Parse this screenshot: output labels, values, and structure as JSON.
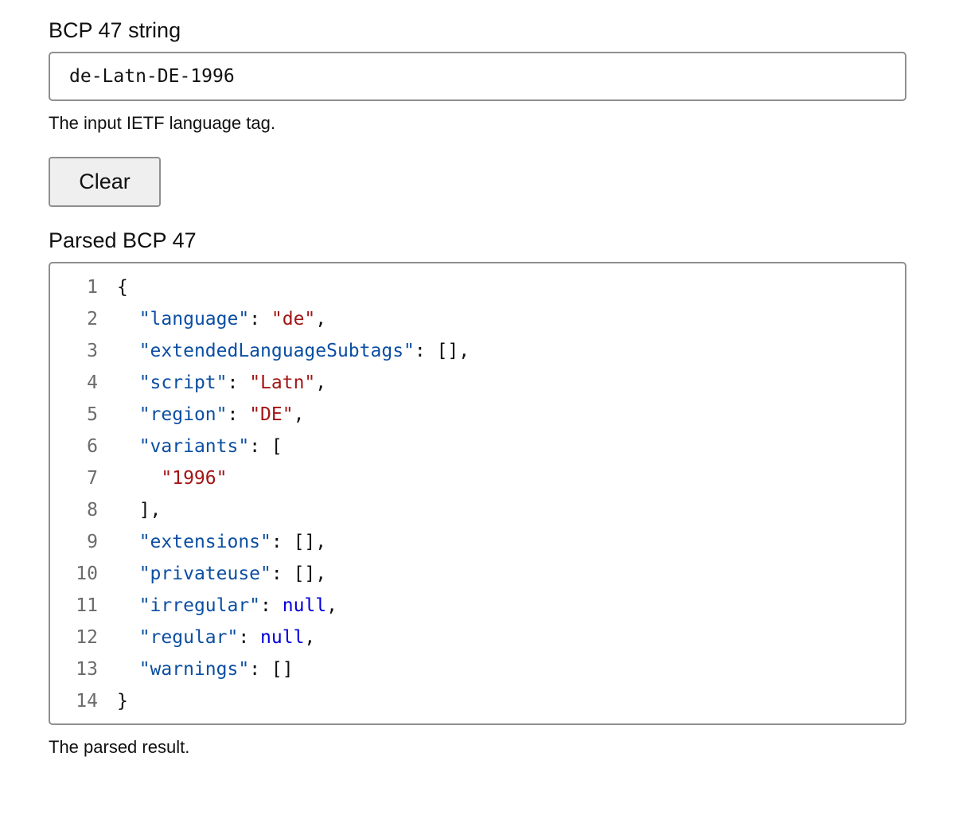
{
  "input_section": {
    "label": "BCP 47 string",
    "value": "de-Latn-DE-1996",
    "help": "The input IETF language tag."
  },
  "clear_button": {
    "label": "Clear"
  },
  "output_section": {
    "label": "Parsed BCP 47",
    "help": "The parsed result.",
    "lines": [
      [
        {
          "t": "punc",
          "v": "{"
        }
      ],
      [
        {
          "t": "punc",
          "v": "  "
        },
        {
          "t": "key",
          "v": "\"language\""
        },
        {
          "t": "punc",
          "v": ": "
        },
        {
          "t": "str",
          "v": "\"de\""
        },
        {
          "t": "punc",
          "v": ","
        }
      ],
      [
        {
          "t": "punc",
          "v": "  "
        },
        {
          "t": "key",
          "v": "\"extendedLanguageSubtags\""
        },
        {
          "t": "punc",
          "v": ": [],"
        }
      ],
      [
        {
          "t": "punc",
          "v": "  "
        },
        {
          "t": "key",
          "v": "\"script\""
        },
        {
          "t": "punc",
          "v": ": "
        },
        {
          "t": "str",
          "v": "\"Latn\""
        },
        {
          "t": "punc",
          "v": ","
        }
      ],
      [
        {
          "t": "punc",
          "v": "  "
        },
        {
          "t": "key",
          "v": "\"region\""
        },
        {
          "t": "punc",
          "v": ": "
        },
        {
          "t": "str",
          "v": "\"DE\""
        },
        {
          "t": "punc",
          "v": ","
        }
      ],
      [
        {
          "t": "punc",
          "v": "  "
        },
        {
          "t": "key",
          "v": "\"variants\""
        },
        {
          "t": "punc",
          "v": ": ["
        }
      ],
      [
        {
          "t": "punc",
          "v": "    "
        },
        {
          "t": "str",
          "v": "\"1996\""
        }
      ],
      [
        {
          "t": "punc",
          "v": "  ],"
        }
      ],
      [
        {
          "t": "punc",
          "v": "  "
        },
        {
          "t": "key",
          "v": "\"extensions\""
        },
        {
          "t": "punc",
          "v": ": [],"
        }
      ],
      [
        {
          "t": "punc",
          "v": "  "
        },
        {
          "t": "key",
          "v": "\"privateuse\""
        },
        {
          "t": "punc",
          "v": ": [],"
        }
      ],
      [
        {
          "t": "punc",
          "v": "  "
        },
        {
          "t": "key",
          "v": "\"irregular\""
        },
        {
          "t": "punc",
          "v": ": "
        },
        {
          "t": "lit",
          "v": "null"
        },
        {
          "t": "punc",
          "v": ","
        }
      ],
      [
        {
          "t": "punc",
          "v": "  "
        },
        {
          "t": "key",
          "v": "\"regular\""
        },
        {
          "t": "punc",
          "v": ": "
        },
        {
          "t": "lit",
          "v": "null"
        },
        {
          "t": "punc",
          "v": ","
        }
      ],
      [
        {
          "t": "punc",
          "v": "  "
        },
        {
          "t": "key",
          "v": "\"warnings\""
        },
        {
          "t": "punc",
          "v": ": []"
        }
      ],
      [
        {
          "t": "punc",
          "v": "}"
        }
      ]
    ]
  }
}
